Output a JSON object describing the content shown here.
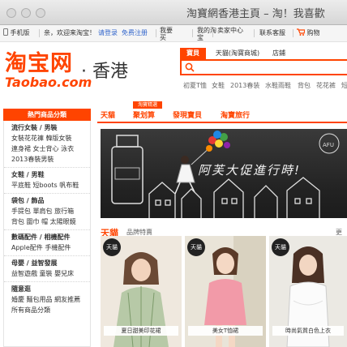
{
  "window": {
    "title": "淘寶網香港主頁 – 淘！我喜歡"
  },
  "topbar": {
    "mobile": "手机版",
    "welcome": "亲，欢迎来淘宝！",
    "login": "请登录",
    "register": "免费注册",
    "buy": "我要买",
    "my_taobao": "我的淘宝",
    "seller_center": "卖家中心",
    "support": "联系客服",
    "cart": "购物"
  },
  "logo": {
    "cn": "淘宝网",
    "en": "Taobao.com",
    "region": "· 香港"
  },
  "search": {
    "tabs": [
      "寶貝",
      "天貓(淘寶商城)",
      "店鋪"
    ],
    "active_tab": 0,
    "value": "",
    "hot_keywords": [
      "初夏T恤",
      "女鞋",
      "2013春装",
      "水鞋雨鞋",
      "背包",
      "花花裤",
      "短"
    ]
  },
  "categories": {
    "title": "熱門商品分類",
    "groups": [
      {
        "title": "流行女裝 / 男裝",
        "lines": [
          "女裝花花褲  韓版女裝",
          "連身裙  女士背心  泳衣",
          "2013春裝男裝"
        ]
      },
      {
        "title": "女鞋 / 男鞋",
        "lines": [
          "平底鞋  短boots  帆布鞋"
        ]
      },
      {
        "title": "袋包 / 飾品",
        "lines": [
          "手提包  單肩包  旅行箱",
          "背包  圍巾  帽  太陽眼鏡"
        ]
      },
      {
        "title": "數碼配件 / 相機配件",
        "lines": [
          "Apple配件  手機配件"
        ]
      },
      {
        "title": "母嬰 / 益智發展",
        "lines": [
          "益智遊戲  童裝  嬰兒床"
        ]
      },
      {
        "title": "隨意逛",
        "lines": [
          "婚慶  麵包用品  網友推薦",
          "所有商品分類"
        ]
      }
    ]
  },
  "nav": {
    "items": [
      "天貓",
      "聚划算",
      "發現寶貝",
      "淘寶旅行"
    ],
    "badge": "淘寶精選"
  },
  "banner": {
    "text": "阿芙大促進行時!"
  },
  "section": {
    "title": "天貓",
    "subtitle": "品牌特賣",
    "more": "更多",
    "badge": "天貓",
    "products": [
      {
        "label": "夏日甜美印花裙"
      },
      {
        "label": "美女T恤裙"
      },
      {
        "label": "時尚氣質白色上衣"
      }
    ]
  },
  "colors": {
    "brand": "#ff4400",
    "background": "#ffffff"
  }
}
